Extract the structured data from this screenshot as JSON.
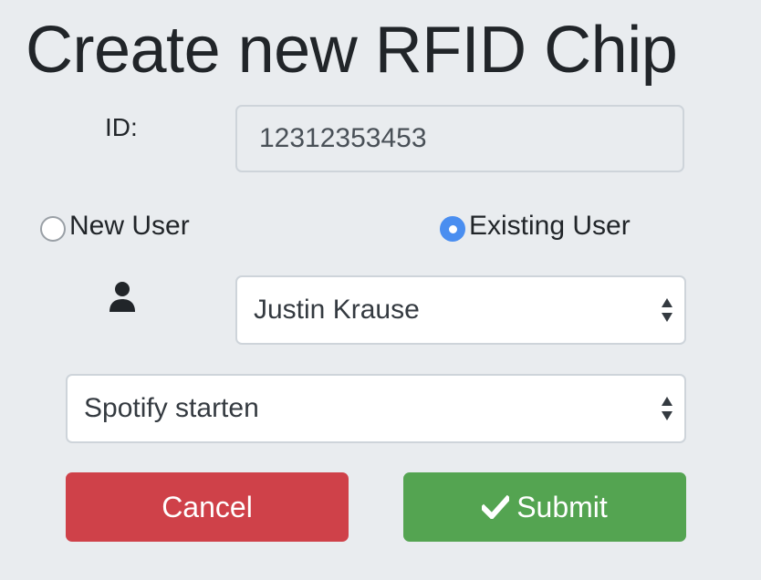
{
  "page": {
    "title": "Create new RFID Chip"
  },
  "form": {
    "id_label": "ID:",
    "id_value": "12312353453",
    "user_type": {
      "options": [
        {
          "label": "New User",
          "checked": false
        },
        {
          "label": "Existing User",
          "checked": true
        }
      ]
    },
    "user_icon": "user-icon",
    "user_select": {
      "selected": "Justin Krause"
    },
    "action_select": {
      "selected": "Spotify starten"
    }
  },
  "buttons": {
    "cancel_label": "Cancel",
    "submit_label": "Submit",
    "submit_icon": "check-icon"
  },
  "colors": {
    "background": "#e9ecef",
    "cancel": "#cf4149",
    "submit": "#54a451",
    "radio_checked": "#4a8ef0"
  }
}
